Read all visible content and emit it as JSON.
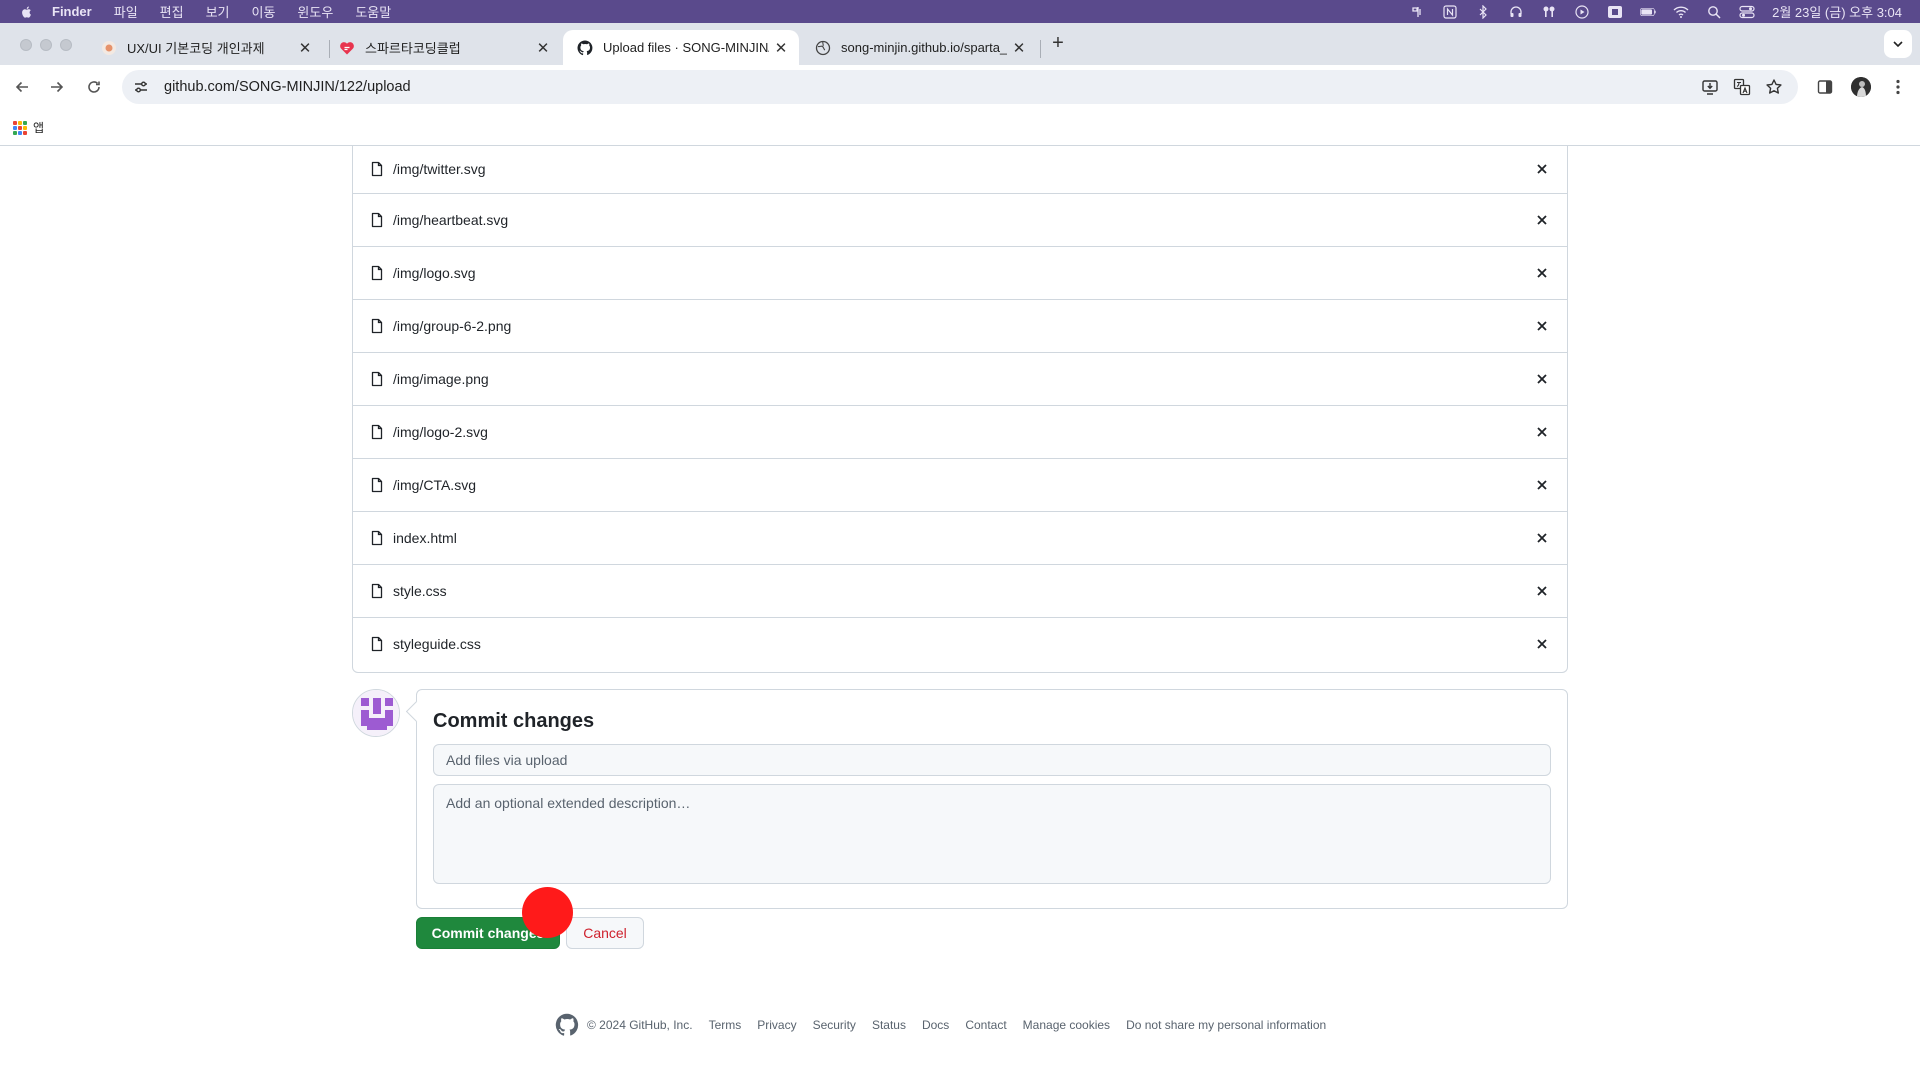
{
  "menubar": {
    "app_name": "Finder",
    "items": [
      "파일",
      "편집",
      "보기",
      "이동",
      "윈도우",
      "도움말"
    ],
    "clock": "2월 23일 (금) 오후 3:04"
  },
  "tabs": [
    {
      "title": "UX/UI 기본코딩 개인과제"
    },
    {
      "title": "스파르타코딩클럽"
    },
    {
      "title": "Upload files · SONG-MINJIN/"
    },
    {
      "title": "song-minjin.github.io/sparta_"
    }
  ],
  "address_bar": {
    "url": "github.com/SONG-MINJIN/122/upload"
  },
  "bookmarks": {
    "apps_label": "앱"
  },
  "files": [
    {
      "name": "/img/twitter.svg"
    },
    {
      "name": "/img/heartbeat.svg"
    },
    {
      "name": "/img/logo.svg"
    },
    {
      "name": "/img/group-6-2.png"
    },
    {
      "name": "/img/image.png"
    },
    {
      "name": "/img/logo-2.svg"
    },
    {
      "name": "/img/CTA.svg"
    },
    {
      "name": "index.html"
    },
    {
      "name": "style.css"
    },
    {
      "name": "styleguide.css"
    }
  ],
  "commit": {
    "title": "Commit changes",
    "summary_placeholder": "Add files via upload",
    "description_placeholder": "Add an optional extended description…",
    "commit_button": "Commit changes",
    "cancel_button": "Cancel"
  },
  "footer": {
    "copyright": "© 2024 GitHub, Inc.",
    "links": [
      "Terms",
      "Privacy",
      "Security",
      "Status",
      "Docs",
      "Contact",
      "Manage cookies",
      "Do not share my personal information"
    ]
  },
  "colors": {
    "menubar": "#5a4a8c",
    "commit_green": "#1f883d",
    "cancel_red": "#cf222e",
    "click_marker": "#ff1a1a"
  }
}
